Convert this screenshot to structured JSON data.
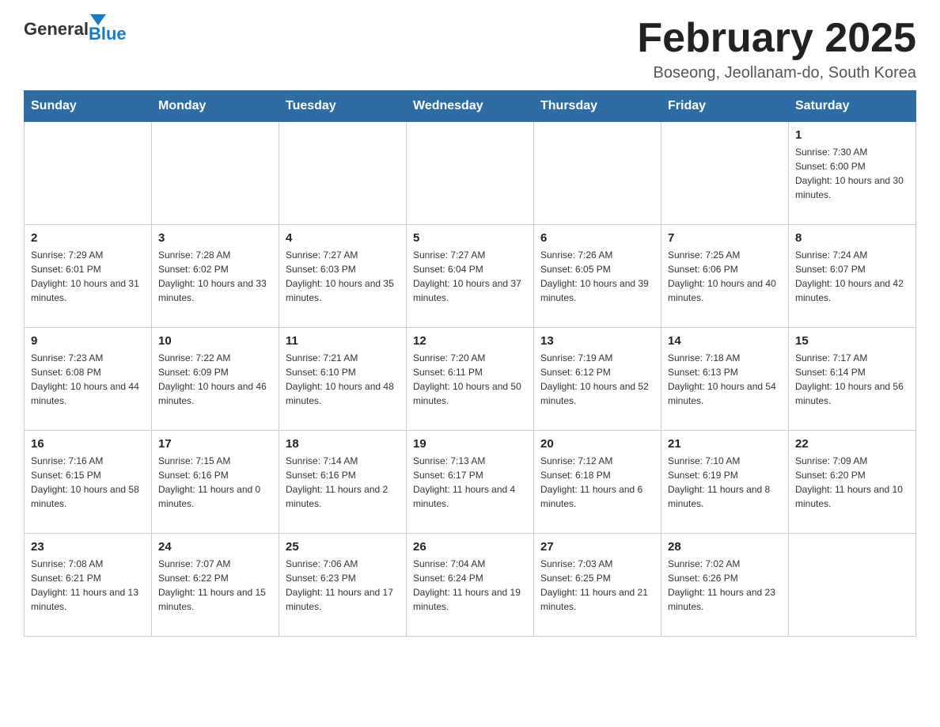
{
  "logo": {
    "general": "General",
    "blue": "Blue"
  },
  "header": {
    "month": "February 2025",
    "location": "Boseong, Jeollanam-do, South Korea"
  },
  "weekdays": [
    "Sunday",
    "Monday",
    "Tuesday",
    "Wednesday",
    "Thursday",
    "Friday",
    "Saturday"
  ],
  "weeks": [
    [
      {
        "day": "",
        "sunrise": "",
        "sunset": "",
        "daylight": ""
      },
      {
        "day": "",
        "sunrise": "",
        "sunset": "",
        "daylight": ""
      },
      {
        "day": "",
        "sunrise": "",
        "sunset": "",
        "daylight": ""
      },
      {
        "day": "",
        "sunrise": "",
        "sunset": "",
        "daylight": ""
      },
      {
        "day": "",
        "sunrise": "",
        "sunset": "",
        "daylight": ""
      },
      {
        "day": "",
        "sunrise": "",
        "sunset": "",
        "daylight": ""
      },
      {
        "day": "1",
        "sunrise": "Sunrise: 7:30 AM",
        "sunset": "Sunset: 6:00 PM",
        "daylight": "Daylight: 10 hours and 30 minutes."
      }
    ],
    [
      {
        "day": "2",
        "sunrise": "Sunrise: 7:29 AM",
        "sunset": "Sunset: 6:01 PM",
        "daylight": "Daylight: 10 hours and 31 minutes."
      },
      {
        "day": "3",
        "sunrise": "Sunrise: 7:28 AM",
        "sunset": "Sunset: 6:02 PM",
        "daylight": "Daylight: 10 hours and 33 minutes."
      },
      {
        "day": "4",
        "sunrise": "Sunrise: 7:27 AM",
        "sunset": "Sunset: 6:03 PM",
        "daylight": "Daylight: 10 hours and 35 minutes."
      },
      {
        "day": "5",
        "sunrise": "Sunrise: 7:27 AM",
        "sunset": "Sunset: 6:04 PM",
        "daylight": "Daylight: 10 hours and 37 minutes."
      },
      {
        "day": "6",
        "sunrise": "Sunrise: 7:26 AM",
        "sunset": "Sunset: 6:05 PM",
        "daylight": "Daylight: 10 hours and 39 minutes."
      },
      {
        "day": "7",
        "sunrise": "Sunrise: 7:25 AM",
        "sunset": "Sunset: 6:06 PM",
        "daylight": "Daylight: 10 hours and 40 minutes."
      },
      {
        "day": "8",
        "sunrise": "Sunrise: 7:24 AM",
        "sunset": "Sunset: 6:07 PM",
        "daylight": "Daylight: 10 hours and 42 minutes."
      }
    ],
    [
      {
        "day": "9",
        "sunrise": "Sunrise: 7:23 AM",
        "sunset": "Sunset: 6:08 PM",
        "daylight": "Daylight: 10 hours and 44 minutes."
      },
      {
        "day": "10",
        "sunrise": "Sunrise: 7:22 AM",
        "sunset": "Sunset: 6:09 PM",
        "daylight": "Daylight: 10 hours and 46 minutes."
      },
      {
        "day": "11",
        "sunrise": "Sunrise: 7:21 AM",
        "sunset": "Sunset: 6:10 PM",
        "daylight": "Daylight: 10 hours and 48 minutes."
      },
      {
        "day": "12",
        "sunrise": "Sunrise: 7:20 AM",
        "sunset": "Sunset: 6:11 PM",
        "daylight": "Daylight: 10 hours and 50 minutes."
      },
      {
        "day": "13",
        "sunrise": "Sunrise: 7:19 AM",
        "sunset": "Sunset: 6:12 PM",
        "daylight": "Daylight: 10 hours and 52 minutes."
      },
      {
        "day": "14",
        "sunrise": "Sunrise: 7:18 AM",
        "sunset": "Sunset: 6:13 PM",
        "daylight": "Daylight: 10 hours and 54 minutes."
      },
      {
        "day": "15",
        "sunrise": "Sunrise: 7:17 AM",
        "sunset": "Sunset: 6:14 PM",
        "daylight": "Daylight: 10 hours and 56 minutes."
      }
    ],
    [
      {
        "day": "16",
        "sunrise": "Sunrise: 7:16 AM",
        "sunset": "Sunset: 6:15 PM",
        "daylight": "Daylight: 10 hours and 58 minutes."
      },
      {
        "day": "17",
        "sunrise": "Sunrise: 7:15 AM",
        "sunset": "Sunset: 6:16 PM",
        "daylight": "Daylight: 11 hours and 0 minutes."
      },
      {
        "day": "18",
        "sunrise": "Sunrise: 7:14 AM",
        "sunset": "Sunset: 6:16 PM",
        "daylight": "Daylight: 11 hours and 2 minutes."
      },
      {
        "day": "19",
        "sunrise": "Sunrise: 7:13 AM",
        "sunset": "Sunset: 6:17 PM",
        "daylight": "Daylight: 11 hours and 4 minutes."
      },
      {
        "day": "20",
        "sunrise": "Sunrise: 7:12 AM",
        "sunset": "Sunset: 6:18 PM",
        "daylight": "Daylight: 11 hours and 6 minutes."
      },
      {
        "day": "21",
        "sunrise": "Sunrise: 7:10 AM",
        "sunset": "Sunset: 6:19 PM",
        "daylight": "Daylight: 11 hours and 8 minutes."
      },
      {
        "day": "22",
        "sunrise": "Sunrise: 7:09 AM",
        "sunset": "Sunset: 6:20 PM",
        "daylight": "Daylight: 11 hours and 10 minutes."
      }
    ],
    [
      {
        "day": "23",
        "sunrise": "Sunrise: 7:08 AM",
        "sunset": "Sunset: 6:21 PM",
        "daylight": "Daylight: 11 hours and 13 minutes."
      },
      {
        "day": "24",
        "sunrise": "Sunrise: 7:07 AM",
        "sunset": "Sunset: 6:22 PM",
        "daylight": "Daylight: 11 hours and 15 minutes."
      },
      {
        "day": "25",
        "sunrise": "Sunrise: 7:06 AM",
        "sunset": "Sunset: 6:23 PM",
        "daylight": "Daylight: 11 hours and 17 minutes."
      },
      {
        "day": "26",
        "sunrise": "Sunrise: 7:04 AM",
        "sunset": "Sunset: 6:24 PM",
        "daylight": "Daylight: 11 hours and 19 minutes."
      },
      {
        "day": "27",
        "sunrise": "Sunrise: 7:03 AM",
        "sunset": "Sunset: 6:25 PM",
        "daylight": "Daylight: 11 hours and 21 minutes."
      },
      {
        "day": "28",
        "sunrise": "Sunrise: 7:02 AM",
        "sunset": "Sunset: 6:26 PM",
        "daylight": "Daylight: 11 hours and 23 minutes."
      },
      {
        "day": "",
        "sunrise": "",
        "sunset": "",
        "daylight": ""
      }
    ]
  ]
}
